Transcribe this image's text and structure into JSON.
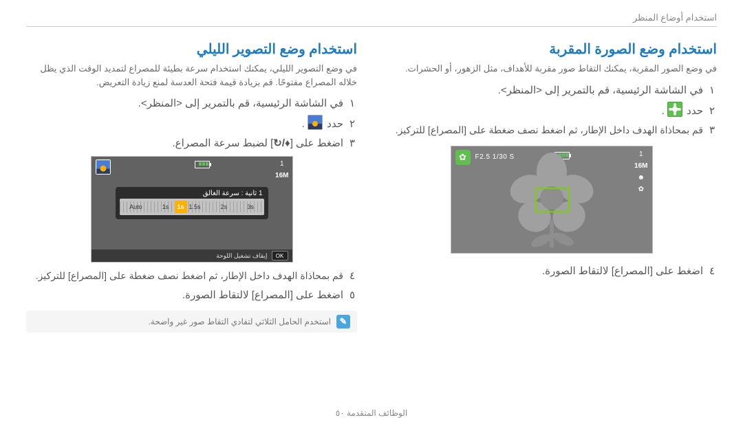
{
  "breadcrumb": "استخدام أوضاع المنظر",
  "right": {
    "heading": "استخدام وضع التصوير الليلي",
    "intro": "في وضع التصوير الليلي، يمكنك استخدام سرعة بطيئة للمصراع لتمديد الوقت الذي يظل خلاله المصراع مفتوحًا. قم بزيادة قيمة فتحة العدسة لمنع زيادة التعريض.",
    "steps": {
      "s1_num": "١",
      "s1": "في الشاشة الرئيسية، قم بالتمرير إلى <المنظر>.",
      "s2_num": "٢",
      "s2": "حدد",
      "s3_num": "٣",
      "s3_a": "اضغط على [",
      "s3_b": "] لضبط سرعة المصراع.",
      "s3_icons": "♦/↻",
      "s4_num": "٤",
      "s4": "قم بمحاذاة الهدف داخل الإطار، ثم اضغط نصف ضغطة على [المصراع] للتركيز.",
      "s5_num": "٥",
      "s5": "اضغط على [المصراع] لالتقاط الصورة."
    },
    "cam": {
      "res": "16M",
      "bars": "1",
      "scale_title": "1 ثانية  :  سرعة الغالق",
      "ticks": [
        "Auto",
        "1s",
        "1.5s",
        "2s",
        "3s"
      ],
      "hilite": "1s",
      "ok_label": "OK",
      "footer": "إيقاف تشغيل اللوحة"
    },
    "note": "استخدم الحامل الثلاثي لتفادي التقاط صور غير واضحة."
  },
  "left": {
    "heading": "استخدام وضع الصورة المقربة",
    "intro": "في وضع الصور المقربة، يمكنك التقاط صور مقربة للأهداف، مثل الزهور، أو الحشرات.",
    "steps": {
      "s1_num": "١",
      "s1": "في الشاشة الرئيسية، قم بالتمرير إلى <المنظر>.",
      "s2_num": "٢",
      "s2": "حدد",
      "s3_num": "٣",
      "s3": "قم بمحاذاة الهدف داخل الإطار، ثم اضغط نصف ضغطة على [المصراع] للتركيز.",
      "s4_num": "٤",
      "s4": "اضغط على [المصراع] لالتقاط الصورة."
    },
    "cam": {
      "exposure": "F2.5 1/30 S",
      "res": "16M",
      "bars": "1"
    }
  },
  "footer": "الوظائف المتقدمة   ٥٠"
}
